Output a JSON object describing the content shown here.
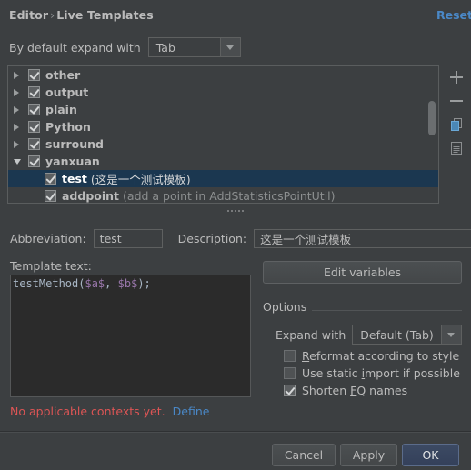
{
  "header": {
    "breadcrumb_root": "Editor",
    "breadcrumb_sep": "›",
    "breadcrumb_leaf": "Live Templates",
    "reset_label": "Reset"
  },
  "expand_default": {
    "label": "By default expand with",
    "value": "Tab",
    "arrow_icon": "chevron-down-icon"
  },
  "tree": {
    "groups": [
      {
        "name": "other",
        "expanded": false,
        "checked": true,
        "twisty": "triangle-right-icon"
      },
      {
        "name": "output",
        "expanded": false,
        "checked": true,
        "twisty": "triangle-right-icon"
      },
      {
        "name": "plain",
        "expanded": false,
        "checked": true,
        "twisty": "triangle-right-icon"
      },
      {
        "name": "Python",
        "expanded": false,
        "checked": true,
        "twisty": "triangle-right-icon"
      },
      {
        "name": "surround",
        "expanded": false,
        "checked": true,
        "twisty": "triangle-right-icon"
      },
      {
        "name": "yanxuan",
        "expanded": true,
        "checked": true,
        "twisty": "triangle-down-icon"
      }
    ],
    "children": [
      {
        "name": "test",
        "description": "(这是一个测试模板)",
        "checked": true,
        "selected": true
      },
      {
        "name": "addpoint",
        "description": "(add a point in AddStatisticsPointUtil)",
        "checked": true,
        "selected": false
      }
    ]
  },
  "tree_toolbar": [
    {
      "icon": "plus-icon",
      "name": "add-template-button"
    },
    {
      "icon": "minus-icon",
      "name": "remove-template-button"
    },
    {
      "icon": "copy-icon",
      "name": "duplicate-template-button"
    },
    {
      "icon": "document-icon",
      "name": "change-context-button"
    }
  ],
  "fields": {
    "abbreviation_label": "Abbreviation:",
    "abbreviation_value": "test",
    "description_label": "Description:",
    "description_value": "这是一个测试模板",
    "template_text_label": "Template text:",
    "template_text_prefix": "testMethod(",
    "template_text_var1": "$a$",
    "template_text_mid": ", ",
    "template_text_var2": "$b$",
    "template_text_suffix": ");",
    "edit_variables_label": "Edit variables"
  },
  "options": {
    "title": "Options",
    "expand_with_label": "Expand with",
    "expand_with_value": "Default (Tab)",
    "checkboxes": [
      {
        "label_before": "",
        "mnemonic": "R",
        "label_after": "eformat according to style",
        "checked": false
      },
      {
        "label_before": "Use static ",
        "mnemonic": "i",
        "label_after": "mport if possible",
        "checked": false
      },
      {
        "label_before": "Shorten ",
        "mnemonic": "F",
        "label_after": "Q names",
        "checked": true
      }
    ]
  },
  "context": {
    "warning": "No applicable contexts yet.",
    "define_label": "Define"
  },
  "buttons": {
    "cancel": "Cancel",
    "apply": "Apply",
    "ok": "OK"
  },
  "colors": {
    "background": "#3c3f41",
    "selection": "#1b3750",
    "link": "#4a88c7",
    "warning": "#dd5555",
    "editor_bg": "#2b2b2b",
    "variable": "#9876aa",
    "code": "#a9b7c6"
  }
}
